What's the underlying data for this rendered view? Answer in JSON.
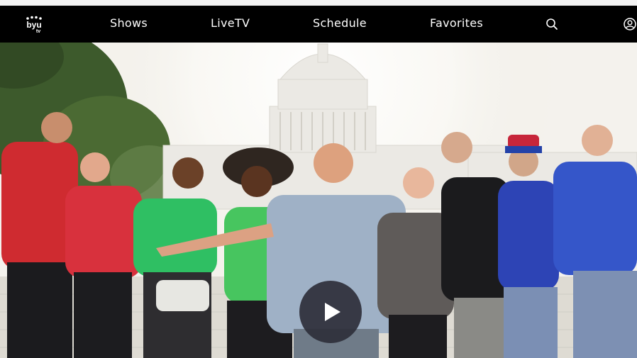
{
  "brand": {
    "logo_text": "byutv"
  },
  "nav": {
    "items": [
      {
        "label": "Shows"
      },
      {
        "label": "LiveTV"
      },
      {
        "label": "Schedule"
      },
      {
        "label": "Favorites"
      }
    ],
    "search_icon": "search-icon",
    "account_icon": "account-icon"
  },
  "hero": {
    "image": "Group of people with arms open in front of the U.S. Capitol",
    "play_icon": "play-icon"
  },
  "colors": {
    "nav_background": "#000000",
    "nav_text": "#ffffff",
    "play_button": "#2e2f3a"
  }
}
